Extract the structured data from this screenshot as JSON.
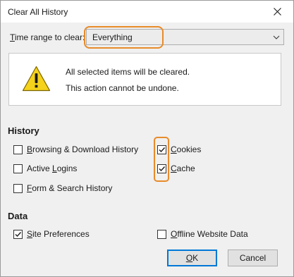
{
  "dialog": {
    "title": "Clear All History"
  },
  "time_range": {
    "label_hotkey": "T",
    "label_rest": "ime range to clear:",
    "selected": "Everything"
  },
  "warning": {
    "icon": "warning-icon",
    "line1": "All selected items will be cleared.",
    "line2": "This action cannot be undone."
  },
  "history": {
    "heading": "History",
    "items": [
      {
        "pre": "",
        "hotkey": "B",
        "post": "rowsing & Download History",
        "checked": false
      },
      {
        "pre": "",
        "hotkey": "C",
        "post": "ookies",
        "checked": true
      },
      {
        "pre": "Active ",
        "hotkey": "L",
        "post": "ogins",
        "checked": false
      },
      {
        "pre": "",
        "hotkey": "C",
        "post": "ache",
        "checked": true
      },
      {
        "pre": "",
        "hotkey": "F",
        "post": "orm & Search History",
        "checked": false
      }
    ]
  },
  "data_section": {
    "heading": "Data",
    "items": [
      {
        "pre": "",
        "hotkey": "S",
        "post": "ite Preferences",
        "checked": true
      },
      {
        "pre": "",
        "hotkey": "O",
        "post": "ffline Website Data",
        "checked": false
      }
    ]
  },
  "buttons": {
    "ok_hotkey": "O",
    "ok_rest": "K",
    "cancel": "Cancel"
  },
  "colors": {
    "highlight": "#e88b2a",
    "default_button_border": "#0078d7"
  }
}
